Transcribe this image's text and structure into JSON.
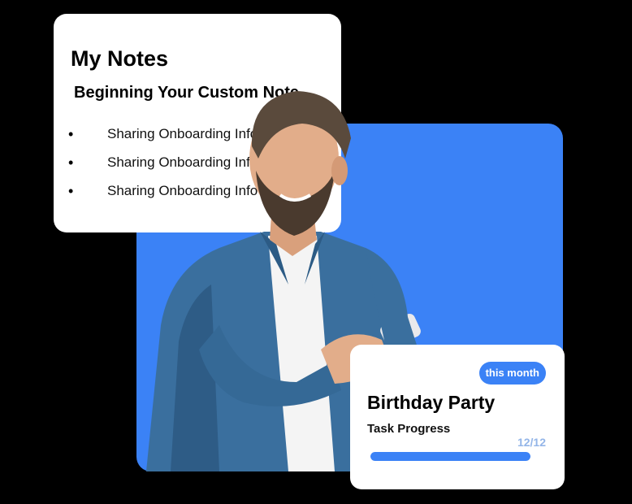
{
  "notes_card": {
    "title": "My Notes",
    "subtitle": "Beginning Your Custom Note",
    "items": [
      {
        "text": "Sharing Onboarding Info"
      },
      {
        "text": "Sharing Onboarding Info"
      },
      {
        "text": "Sharing Onboarding Info"
      }
    ]
  },
  "progress_card": {
    "badge": "this month",
    "title": "Birthday Party",
    "label": "Task Progress",
    "count_text": "12/12",
    "progress_fraction": 1.0
  },
  "colors": {
    "background": "#000000",
    "accent_blue": "#3b82f6",
    "card": "#ffffff",
    "count_text": "#93b5e8"
  },
  "icons": {
    "bullet": "bullet-dot"
  }
}
